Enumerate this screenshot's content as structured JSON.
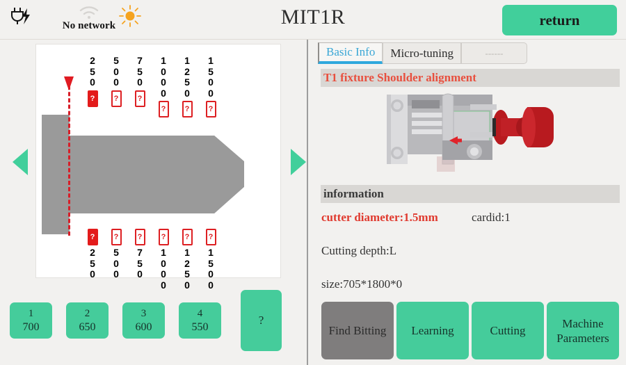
{
  "statusbar": {
    "power_icon": "power-plug-charging-icon",
    "wifi_icon": "wifi-off-icon",
    "network_label": "No network",
    "brightness_icon": "sun-brightness-icon",
    "title": "MIT1R",
    "return_label": "return"
  },
  "left_panel": {
    "nav_prev_icon": "arrow-left-icon",
    "nav_next_icon": "arrow-right-icon",
    "diagram": {
      "reference_marker": "reference-line-marker",
      "top_positions": [
        {
          "value": "250",
          "digits": [
            "2",
            "5",
            "0"
          ],
          "badge": "?",
          "filled": true
        },
        {
          "value": "500",
          "digits": [
            "5",
            "0",
            "0"
          ],
          "badge": "?",
          "filled": false
        },
        {
          "value": "750",
          "digits": [
            "7",
            "5",
            "0"
          ],
          "badge": "?",
          "filled": false
        },
        {
          "value": "1000",
          "digits": [
            "1",
            "0",
            "0",
            "0"
          ],
          "badge": "?",
          "filled": false
        },
        {
          "value": "1250",
          "digits": [
            "1",
            "2",
            "5",
            "0"
          ],
          "badge": "?",
          "filled": false
        },
        {
          "value": "1500",
          "digits": [
            "1",
            "5",
            "0",
            "0"
          ],
          "badge": "?",
          "filled": false
        }
      ],
      "bottom_positions": [
        {
          "value": "250",
          "digits": [
            "2",
            "5",
            "0"
          ],
          "badge": "?",
          "filled": true
        },
        {
          "value": "500",
          "digits": [
            "5",
            "0",
            "0"
          ],
          "badge": "?",
          "filled": false
        },
        {
          "value": "750",
          "digits": [
            "7",
            "5",
            "0"
          ],
          "badge": "?",
          "filled": false
        },
        {
          "value": "1000",
          "digits": [
            "1",
            "0",
            "0",
            "0"
          ],
          "badge": "?",
          "filled": false
        },
        {
          "value": "1250",
          "digits": [
            "1",
            "2",
            "5",
            "0"
          ],
          "badge": "?",
          "filled": false
        },
        {
          "value": "1500",
          "digits": [
            "1",
            "5",
            "0",
            "0"
          ],
          "badge": "?",
          "filled": false
        }
      ]
    },
    "slots": [
      {
        "index": "1",
        "value": "700"
      },
      {
        "index": "2",
        "value": "650"
      },
      {
        "index": "3",
        "value": "600"
      },
      {
        "index": "4",
        "value": "550"
      }
    ],
    "help_label": "?"
  },
  "right_panel": {
    "tabs": [
      {
        "label": "Basic Info",
        "active": true
      },
      {
        "label": "Micro-tuning",
        "active": false
      },
      {
        "label": "------",
        "active": false
      }
    ],
    "fixture_title": "T1 fixture Shoulder alignment",
    "machine_image": "fixture-clamp-3d-render",
    "information_header": "information",
    "cutter_diameter": "cutter diameter:1.5mm",
    "cardid": "cardid:1",
    "cutting_depth": "Cutting depth:L",
    "size": "size:705*1800*0",
    "actions": [
      {
        "label": "Find Bitting",
        "disabled": true
      },
      {
        "label": "Learning",
        "disabled": false
      },
      {
        "label": "Cutting",
        "disabled": false
      },
      {
        "label": "Machine Parameters",
        "disabled": false
      }
    ]
  },
  "colors": {
    "accent_green": "#41cf9b",
    "alert_red": "#dd1f22",
    "tab_active_blue": "#2fa8dd",
    "title_red": "#e8503f",
    "metal_gray": "#9a9a9a",
    "disabled_gray": "#7f7d7d"
  }
}
